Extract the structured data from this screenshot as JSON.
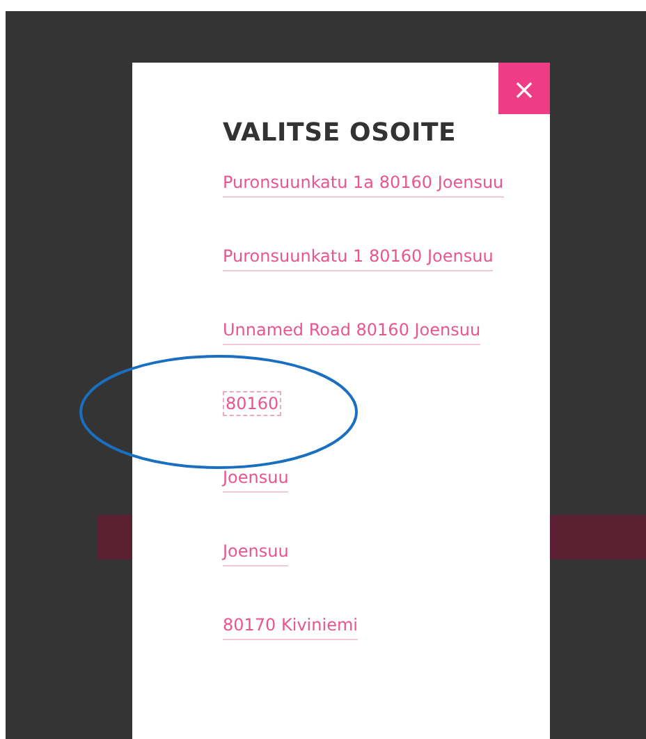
{
  "dialog": {
    "title": "VALITSE OSOITE",
    "close_label": "×",
    "addresses": [
      {
        "text": "Puronsuunkatu 1a 80160 Joensuu",
        "highlighted": false
      },
      {
        "text": "Puronsuunkatu 1 80160 Joensuu",
        "highlighted": false
      },
      {
        "text": "Unnamed Road 80160 Joensuu",
        "highlighted": false
      },
      {
        "text": "80160",
        "highlighted": true
      },
      {
        "text": "Joensuu",
        "highlighted": false
      },
      {
        "text": "Joensuu",
        "highlighted": false
      },
      {
        "text": "80170 Kiviniemi",
        "highlighted": false
      }
    ]
  }
}
